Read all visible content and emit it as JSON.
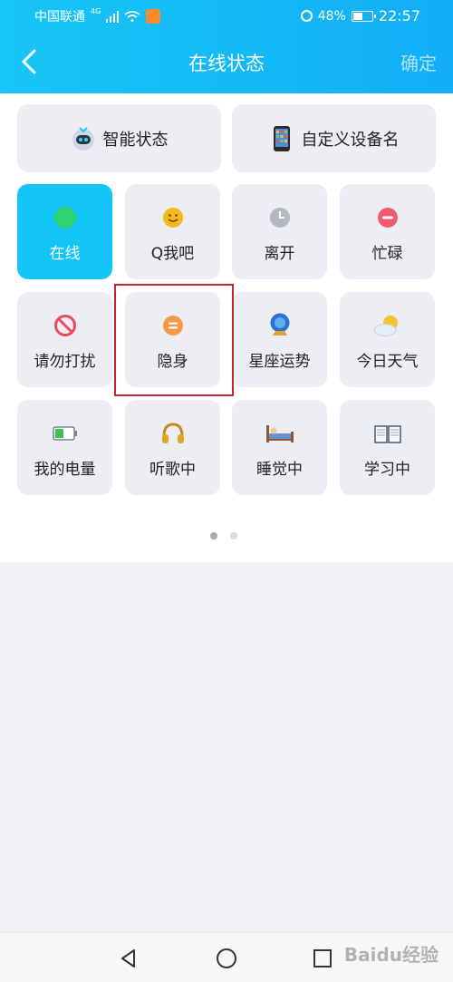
{
  "status_bar": {
    "carrier": "中国联通",
    "network": "4G",
    "battery_pct": "48%",
    "time": "22:57"
  },
  "header": {
    "title": "在线状态",
    "confirm_label": "确定",
    "back_icon": "chevron-left-icon"
  },
  "top_buttons": [
    {
      "label": "智能状态",
      "icon": "robot-icon"
    },
    {
      "label": "自定义设备名",
      "icon": "phone-icon"
    }
  ],
  "status_tiles": [
    {
      "label": "在线",
      "icon": "green-dot-icon",
      "selected": true
    },
    {
      "label": "Q我吧",
      "icon": "smile-icon",
      "selected": false
    },
    {
      "label": "离开",
      "icon": "clock-icon",
      "selected": false
    },
    {
      "label": "忙碌",
      "icon": "minus-circle-icon",
      "selected": false
    },
    {
      "label": "请勿打扰",
      "icon": "no-entry-icon",
      "selected": false
    },
    {
      "label": "隐身",
      "icon": "equals-circle-icon",
      "selected": false
    },
    {
      "label": "星座运势",
      "icon": "crystal-ball-icon",
      "selected": false
    },
    {
      "label": "今日天气",
      "icon": "weather-icon",
      "selected": false
    },
    {
      "label": "我的电量",
      "icon": "battery-icon",
      "selected": false
    },
    {
      "label": "听歌中",
      "icon": "headphones-icon",
      "selected": false
    },
    {
      "label": "睡觉中",
      "icon": "bed-icon",
      "selected": false
    },
    {
      "label": "学习中",
      "icon": "book-icon",
      "selected": false
    }
  ],
  "pager": {
    "current": 1,
    "total": 2
  },
  "colors": {
    "header_start": "#16c6f6",
    "header_end": "#12aef7",
    "selected_tile": "#13c4f6",
    "tile_bg": "#eceef3",
    "highlight": "#c0262d"
  },
  "watermark": "Baidu经验"
}
